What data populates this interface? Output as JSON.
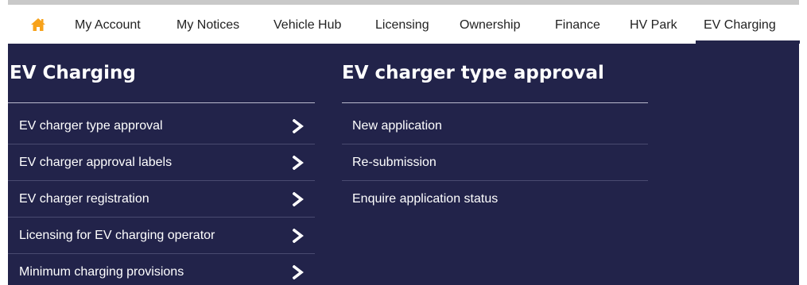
{
  "nav": {
    "home_icon": "home-icon",
    "home_color": "#f7a21b",
    "items": [
      {
        "label": "My Account"
      },
      {
        "label": "My Notices"
      },
      {
        "label": "Vehicle Hub"
      },
      {
        "label": "Licensing"
      },
      {
        "label": "Ownership"
      },
      {
        "label": "Finance"
      },
      {
        "label": "HV Park"
      },
      {
        "label": "EV Charging",
        "active": true
      }
    ]
  },
  "mega_menu": {
    "background": "#22234a",
    "section_title": "EV Charging",
    "items": [
      {
        "label": "EV charger type approval",
        "icon": "chevron-right-icon"
      },
      {
        "label": "EV charger approval labels",
        "icon": "chevron-right-icon"
      },
      {
        "label": "EV charger registration",
        "icon": "chevron-right-icon"
      },
      {
        "label": "Licensing for EV charging operator",
        "icon": "chevron-right-icon"
      },
      {
        "label": "Minimum charging provisions",
        "icon": "chevron-right-icon"
      }
    ],
    "submenu": {
      "title": "EV charger type approval",
      "items": [
        {
          "label": "New application"
        },
        {
          "label": "Re-submission"
        },
        {
          "label": "Enquire application status"
        }
      ]
    }
  }
}
